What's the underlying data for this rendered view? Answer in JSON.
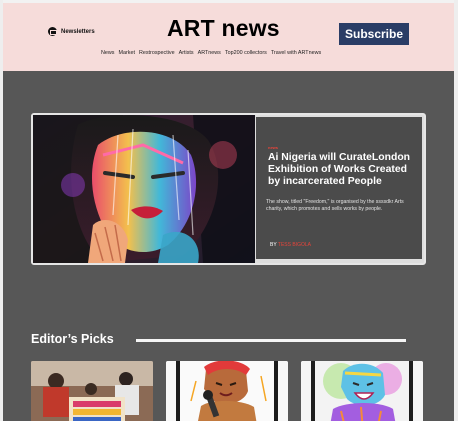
{
  "header": {
    "newsletters_label": "Newsletters",
    "newsletters_icon": "newsletter-icon",
    "logo": "ART news",
    "subscribe_label": "Subscribe",
    "background": "#f6dcda",
    "subscribe_color": "#2a3d66"
  },
  "nav": {
    "items": [
      "News",
      "Market",
      "Restrospective",
      "Artists",
      "ARTnews",
      "Top200 collectors",
      "Travel with ARTnews"
    ]
  },
  "feature": {
    "tag": "news",
    "headline": "Ai Nigeria will CurateLondon Exhibition of Works Created by incarcerated People",
    "dek": "The show, titled \"Freedom,\" is organised by the ssssdkr Arts charity, which promotes and sells works by people.",
    "byline_prefix": "BY",
    "author": "TESS BIGOLA",
    "accent": "#e8443a"
  },
  "editors_picks": {
    "title": "Editor’s Picks"
  },
  "theme": {
    "main_background": "#575757"
  }
}
